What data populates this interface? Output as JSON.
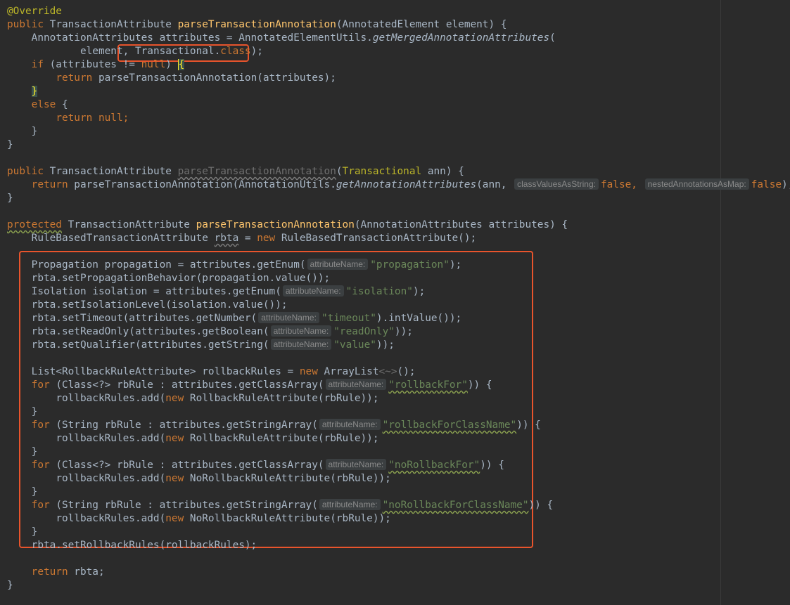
{
  "code": {
    "override": "@Override",
    "kw_public": "public",
    "kw_protected": "protected",
    "kw_if": "if",
    "kw_else": "else",
    "kw_return": "return",
    "kw_null": "null",
    "kw_new": "new",
    "kw_for": "for",
    "kw_false": "false",
    "kw_class": "class",
    "type_TransactionAttribute": "TransactionAttribute",
    "fn_parseTransactionAnnotation": "parseTransactionAnnotation",
    "sig1_params": "(AnnotatedElement element) {",
    "l2_a": "AnnotationAttributes attributes = AnnotatedElementUtils.",
    "l2_fn": "getMergedAnnotationAttributes",
    "l2_b": "(",
    "l3_a": "element, ",
    "l3_class_name": "Transactional",
    "l3_dot": ".",
    "l3_end": ");",
    "l4_a": " (attributes != ",
    "l4_b": ") ",
    "l4_brace": "{",
    "l5_a": "parseTransactionAnnotation(attributes);",
    "brace_close": "}",
    "brace_open": "{",
    "semi": ";",
    "sig2_params_open": "(",
    "sig2_type": "Transactional",
    "sig2_params_close": " ann) {",
    "l10_a": " parseTransactionAnnotation(AnnotationUtils.",
    "l10_fn": "getAnnotationAttributes",
    "l10_b": "(ann, ",
    "hint_classValuesAsString": "classValuesAsString:",
    "hint_nestedAnnotationsAsMap": "nestedAnnotationsAsMap:",
    "comma": ", ",
    "l10_end": ");",
    "sig3_params": "(AnnotationAttributes attributes) {",
    "l13_a": "RuleBasedTransactionAttribute ",
    "l13_rbta": "rbta",
    "l13_b": " = ",
    "l13_c": " RuleBasedTransactionAttribute();",
    "hint_attributeName": "attributeName:",
    "l15_a": "Propagation propagation = attributes.getEnum(",
    "l15_str": "\"propagation\"",
    "l15_end": ");",
    "l16": "rbta.setPropagationBehavior(propagation.value());",
    "l17_a": "Isolation isolation = attributes.getEnum(",
    "l17_str": "\"isolation\"",
    "l17_end": ");",
    "l18": "rbta.setIsolationLevel(isolation.value());",
    "l19_a": "rbta.setTimeout(attributes.getNumber(",
    "l19_str": "\"timeout\"",
    "l19_end": ").intValue());",
    "l20_a": "rbta.setReadOnly(attributes.getBoolean(",
    "l20_str": "\"readOnly\"",
    "l20_end": "));",
    "l21_a": "rbta.setQualifier(attributes.getString(",
    "l21_str": "\"value\"",
    "l21_end": "));",
    "l23_a": "List<RollbackRuleAttribute> rollbackRules = ",
    "l23_b": " ArrayList",
    "l23_diamond": "<~>",
    "l23_end": "();",
    "for_class_a": " (Class<?> rbRule : attributes.getClassArray(",
    "for_string_a": " (String rbRule : attributes.getStringArray(",
    "str_rollbackFor": "\"rollbackFor\"",
    "str_rollbackForClassName": "\"rollbackForClassName\"",
    "str_noRollbackFor": "\"noRollbackFor\"",
    "str_noRollbackForClassName": "\"noRollbackForClassName\"",
    "for_end": ")) {",
    "add_a": "rollbackRules.add(",
    "add_rollback": " RollbackRuleAttribute(rbRule));",
    "add_norollback": " NoRollbackRuleAttribute(rbRule));",
    "l36": "rbta.setRollbackRules(rollbackRules);",
    "l38_b": " rbta;"
  },
  "colors": {
    "background": "#2b2b2b",
    "keyword": "#cc7832",
    "annotation": "#bbb529",
    "method_decl": "#ffc66d",
    "string": "#6a8759",
    "text": "#a9b7c6",
    "highlight_box": "#e8542c"
  }
}
